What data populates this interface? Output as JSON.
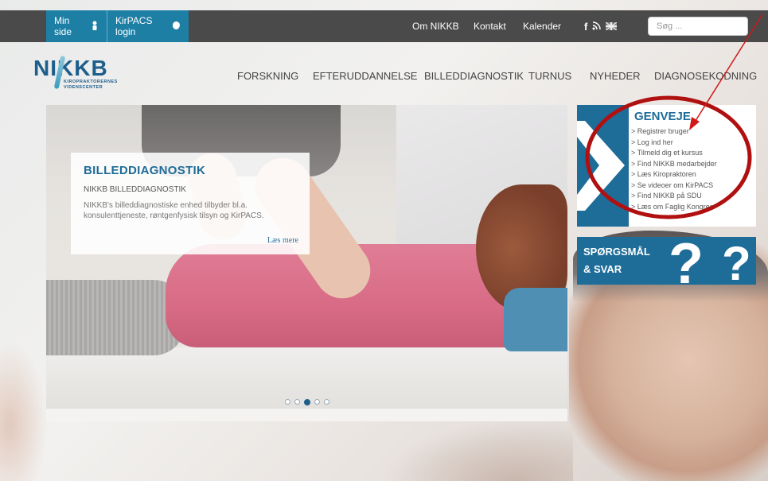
{
  "topbar": {
    "min_side": "Min side",
    "kirpacs_login": "KirPACS login",
    "links": [
      "Om NIKKB",
      "Kontakt",
      "Kalender"
    ],
    "search_placeholder": "Søg ..."
  },
  "logo": {
    "name": "NIKKB",
    "tagline_1": "KIROPRAKTORERNES",
    "tagline_2": "VIDENSCENTER"
  },
  "nav": {
    "items": [
      "FORSKNING",
      "EFTERUDDANNELSE",
      "BILLEDDIAGNOSTIK",
      "TURNUS",
      "NYHEDER",
      "DIAGNOSEKODNING"
    ]
  },
  "slide": {
    "title": "BILLEDDIAGNOSTIK",
    "subtitle": "NIKKB BILLEDDIAGNOSTIK",
    "text": "NIKKB's billeddiagnostiske enhed tilbyder bl.a. konsulenttjeneste, røntgenfysisk tilsyn og KirPACS.",
    "read_more": "Læs mere",
    "dot_count": 5,
    "active_dot": 2
  },
  "genveje": {
    "title": "GENVEJE",
    "items": [
      "> Registrer bruger",
      "> Log ind her",
      "> Tilmeld dig et kursus",
      "> Find NIKKB medarbejder",
      "> Læs Kiropraktoren",
      "> Se videoer om KirPACS",
      "> Find NIKKB på SDU",
      "> Læs om Faglig Kongres"
    ]
  },
  "qa": {
    "line1": "SPØRGSMÅL",
    "line2": "& SVAR"
  },
  "colors": {
    "brand_blue": "#1e6c98",
    "topbar": "#4a4a4a",
    "annotation_red": "#b01010"
  }
}
